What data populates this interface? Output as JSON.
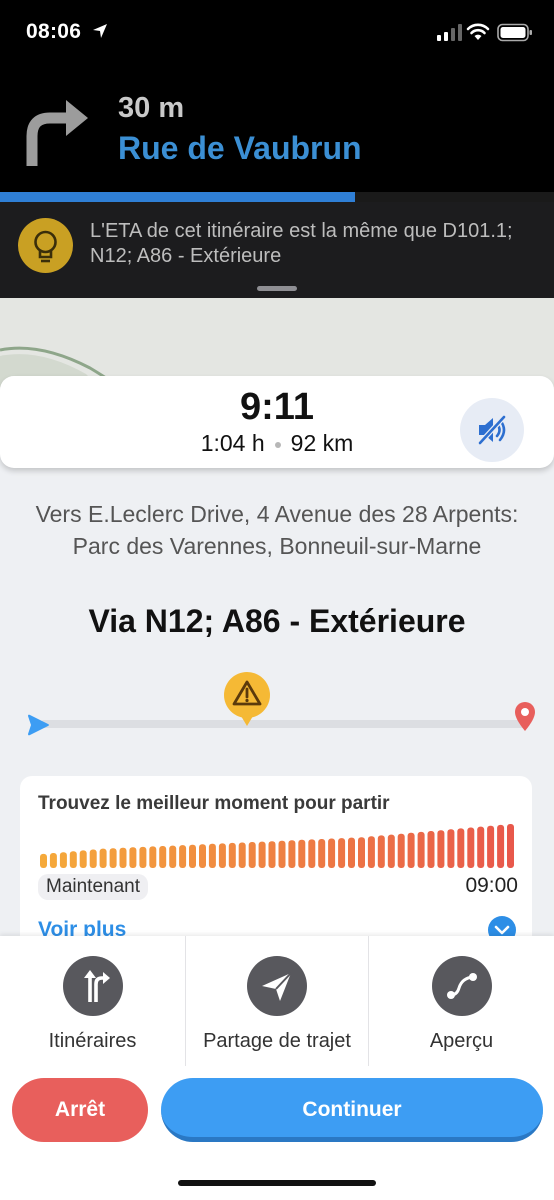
{
  "status_bar": {
    "time": "08:06",
    "icons": [
      "location-arrow-icon",
      "signal-icon",
      "wifi-icon",
      "battery-icon"
    ]
  },
  "navigation": {
    "distance": "30 m",
    "street": "Rue de Vaubrun",
    "turn_icon": "turn-right-icon",
    "progress": 0.64
  },
  "tip": {
    "icon": "lightbulb-icon",
    "text": "L'ETA de cet itinéraire est la même que D101.1; N12; A86 - Extérieure"
  },
  "eta": {
    "arrival_time": "9:11",
    "duration": "1:04 h",
    "distance": "92 km",
    "mute_icon": "sound-off-icon"
  },
  "destination": {
    "text": "Vers E.Leclerc Drive, 4 Avenue des 28 Arpents: Parc des Varennes, Bonneuil-sur-Marne",
    "via": "Via N12; A86 - Extérieure"
  },
  "route_preview": {
    "start_icon": "start-arrow-icon",
    "end_icon": "destination-pin-icon",
    "hazard_icon": "hazard-warning-icon",
    "hazard_position": 0.44
  },
  "departure_planner": {
    "title": "Trouvez le meilleur moment pour partir",
    "start_label": "Maintenant",
    "end_label": "09:00",
    "more_link": "Voir plus",
    "bar_levels": [
      0.32,
      0.34,
      0.36,
      0.38,
      0.4,
      0.42,
      0.44,
      0.45,
      0.46,
      0.47,
      0.48,
      0.49,
      0.5,
      0.51,
      0.52,
      0.53,
      0.54,
      0.55,
      0.56,
      0.57,
      0.58,
      0.59,
      0.6,
      0.61,
      0.62,
      0.63,
      0.64,
      0.65,
      0.66,
      0.67,
      0.68,
      0.69,
      0.7,
      0.72,
      0.74,
      0.76,
      0.78,
      0.8,
      0.82,
      0.84,
      0.86,
      0.88,
      0.9,
      0.92,
      0.94,
      0.96,
      0.98,
      1.0
    ]
  },
  "actions": [
    {
      "label": "Itinéraires",
      "icon": "routes-icon"
    },
    {
      "label": "Partage de trajet",
      "icon": "share-trip-icon"
    },
    {
      "label": "Aperçu",
      "icon": "overview-icon"
    }
  ],
  "buttons": {
    "stop": "Arrêt",
    "continue": "Continuer"
  },
  "colors": {
    "street_blue": "#3b8fd4",
    "progress_blue": "#2f7fd6",
    "stop_red": "#e85f5c",
    "continue_blue": "#3d9df3",
    "bar_start": "#f5a93a",
    "bar_end": "#e8584b"
  }
}
